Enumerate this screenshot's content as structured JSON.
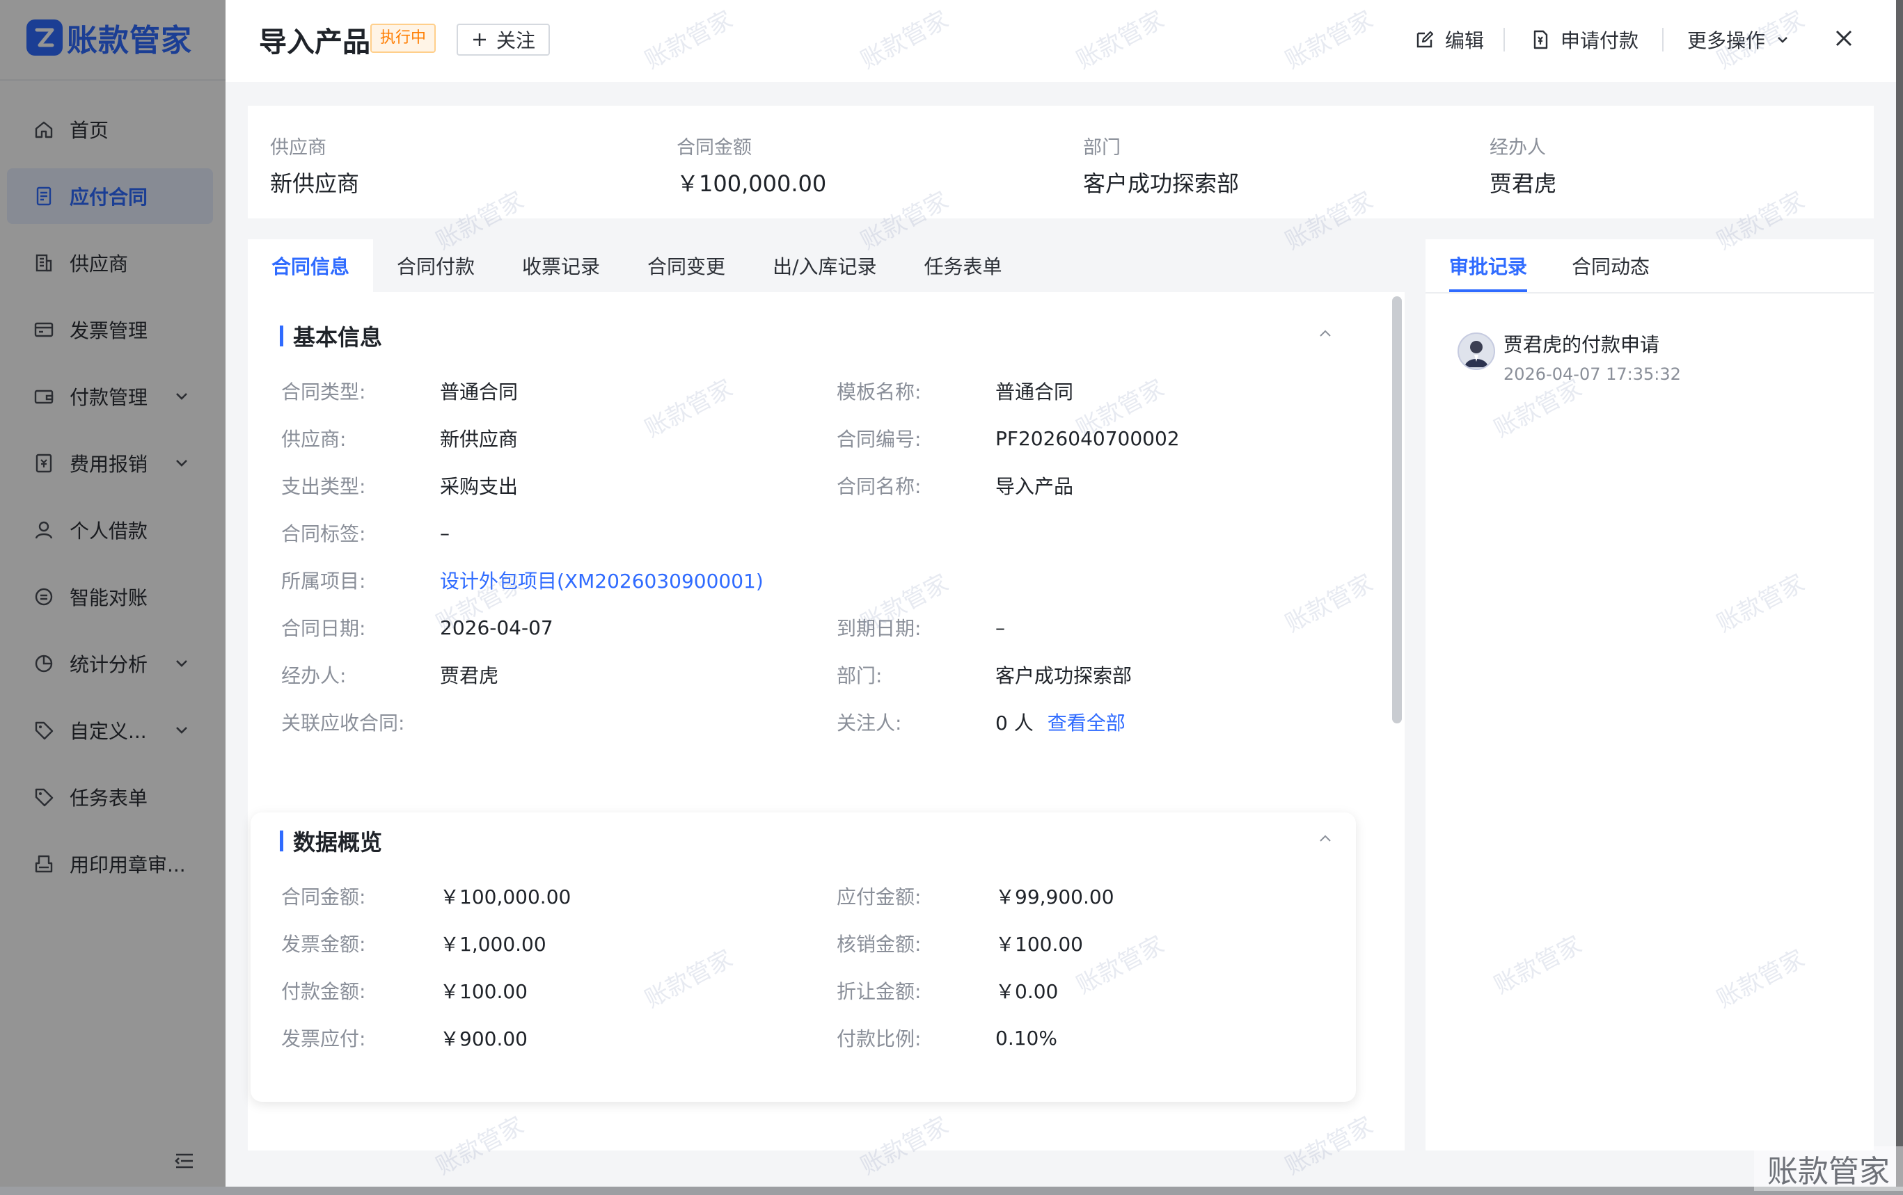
{
  "app": {
    "name": "账款管家",
    "brand_color": "#2f6bff",
    "watermark_text": "账款管家"
  },
  "sidebar": {
    "items": [
      {
        "label": "首页",
        "icon": "home-icon"
      },
      {
        "label": "应付合同",
        "icon": "contract-icon",
        "active": true
      },
      {
        "label": "供应商",
        "icon": "building-icon"
      },
      {
        "label": "发票管理",
        "icon": "invoice-icon"
      },
      {
        "label": "付款管理",
        "icon": "wallet-icon",
        "has_children": true
      },
      {
        "label": "费用报销",
        "icon": "receipt-icon",
        "has_children": true
      },
      {
        "label": "个人借款",
        "icon": "user-icon"
      },
      {
        "label": "智能对账",
        "icon": "reconcile-icon"
      },
      {
        "label": "统计分析",
        "icon": "pie-chart-icon",
        "has_children": true
      },
      {
        "label": "自定义...",
        "icon": "tag-icon",
        "has_children": true
      },
      {
        "label": "任务表单",
        "icon": "tag-icon"
      },
      {
        "label": "用印用章审...",
        "icon": "stamp-icon"
      }
    ]
  },
  "drawer": {
    "title": "导入产品",
    "status": "执行中",
    "follow_label": "关注",
    "actions": {
      "edit": "编辑",
      "apply_payment": "申请付款",
      "more": "更多操作"
    }
  },
  "summary": [
    {
      "label": "供应商",
      "value": "新供应商"
    },
    {
      "label": "合同金额",
      "value": "￥100,000.00"
    },
    {
      "label": "部门",
      "value": "客户成功探索部"
    },
    {
      "label": "经办人",
      "value": "贾君虎"
    }
  ],
  "tabs": [
    "合同信息",
    "合同付款",
    "收票记录",
    "合同变更",
    "出/入库记录",
    "任务表单"
  ],
  "right_tabs": [
    "审批记录",
    "合同动态"
  ],
  "basic_info": {
    "title": "基本信息",
    "rows": [
      {
        "label": "合同类型:",
        "value": "普通合同",
        "label2": "模板名称:",
        "value2": "普通合同"
      },
      {
        "label": "供应商:",
        "value": "新供应商",
        "label2": "合同编号:",
        "value2": "PF2026040700002"
      },
      {
        "label": "支出类型:",
        "value": "采购支出",
        "label2": "合同名称:",
        "value2": "导入产品"
      },
      {
        "label": "合同标签:",
        "value": "–"
      },
      {
        "label": "所属项目:",
        "value": "设计外包项目(XM2026030900001)"
      },
      {
        "label": "合同日期:",
        "value": "2026-04-07",
        "label2": "到期日期:",
        "value2": "–"
      },
      {
        "label": "经办人:",
        "value": "贾君虎",
        "label2": "部门:",
        "value2": "客户成功探索部"
      },
      {
        "label": "关联应收合同:",
        "value": "",
        "label2": "关注人:",
        "value2": "0 人",
        "link2": "查看全部"
      }
    ]
  },
  "data_overview": {
    "title": "数据概览",
    "rows": [
      {
        "label": "合同金额:",
        "value": "￥100,000.00",
        "label2": "应付金额:",
        "value2": "￥99,900.00"
      },
      {
        "label": "发票金额:",
        "value": "￥1,000.00",
        "label2": "核销金额:",
        "value2": "￥100.00"
      },
      {
        "label": "付款金额:",
        "value": "￥100.00",
        "label2": "折让金额:",
        "value2": "￥0.00"
      },
      {
        "label": "发票应付:",
        "value": "￥900.00",
        "label2": "付款比例:",
        "value2": "0.10%"
      }
    ]
  },
  "approval": [
    {
      "title": "贾君虎的付款申请",
      "time": "2026-04-07 17:35:32"
    }
  ]
}
